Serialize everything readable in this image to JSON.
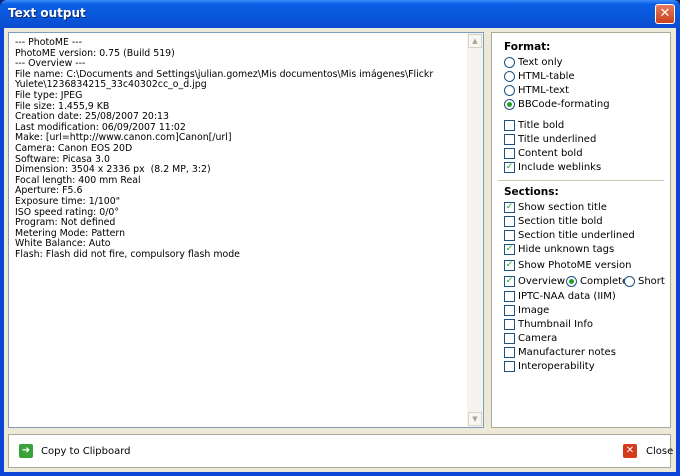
{
  "window": {
    "title": "Text output",
    "close_glyph": "✕"
  },
  "text_output": {
    "lines": [
      "--- PhotoME ---",
      "PhotoME version: 0.75 (Build 519)",
      "--- Overview ---",
      "File name: C:\\Documents and Settings\\julian.gomez\\Mis documentos\\Mis imágenes\\Flickr",
      "Yulete\\1236834215_33c40302cc_o_d.jpg",
      "File type: JPEG",
      "File size: 1.455,9 KB",
      "Creation date: 25/08/2007 20:13",
      "Last modification: 06/09/2007 11:02",
      "Make: [url=http://www.canon.com]Canon[/url]",
      "Camera: Canon EOS 20D",
      "Software: Picasa 3.0",
      "Dimension: 3504 x 2336 px  (8.2 MP, 3:2)",
      "Focal length: 400 mm Real",
      "Aperture: F5.6",
      "Exposure time: 1/100\"",
      "ISO speed rating: 0/0°",
      "Program: Not defined",
      "Metering Mode: Pattern",
      "White Balance: Auto",
      "Flash: Flash did not fire, compulsory flash mode"
    ]
  },
  "format": {
    "heading": "Format:",
    "radios": [
      {
        "label": "Text only",
        "selected": false
      },
      {
        "label": "HTML-table",
        "selected": false
      },
      {
        "label": "HTML-text",
        "selected": false
      },
      {
        "label": "BBCode-formating",
        "selected": true
      }
    ],
    "checks": [
      {
        "label": "Title bold",
        "checked": false
      },
      {
        "label": "Title underlined",
        "checked": false
      },
      {
        "label": "Content bold",
        "checked": false
      },
      {
        "label": "Include weblinks",
        "checked": true
      }
    ]
  },
  "sections": {
    "heading": "Sections:",
    "checks_a": [
      {
        "label": "Show section title",
        "checked": true
      },
      {
        "label": "Section title bold",
        "checked": false
      },
      {
        "label": "Section title underlined",
        "checked": false
      },
      {
        "label": "Hide unknown tags",
        "checked": true
      }
    ],
    "show_photome": {
      "label": "Show PhotoME version",
      "checked": true
    },
    "overview": {
      "label": "Overview",
      "checked": true
    },
    "overview_mode": [
      {
        "label": "Complete",
        "selected": true
      },
      {
        "label": "Short",
        "selected": false
      }
    ],
    "checks_b": [
      {
        "label": "IPTC-NAA data (IIM)",
        "checked": false
      },
      {
        "label": "Image",
        "checked": false
      },
      {
        "label": "Thumbnail Info",
        "checked": false
      },
      {
        "label": "Camera",
        "checked": false
      },
      {
        "label": "Manufacturer notes",
        "checked": false
      },
      {
        "label": "Interoperability",
        "checked": false
      }
    ]
  },
  "footer": {
    "copy_label": "Copy to Clipboard",
    "close_label": "Close"
  },
  "colors": {
    "title_bar": "#0a56d9",
    "check_mark": "#21a121",
    "close_button": "#c9411e"
  }
}
